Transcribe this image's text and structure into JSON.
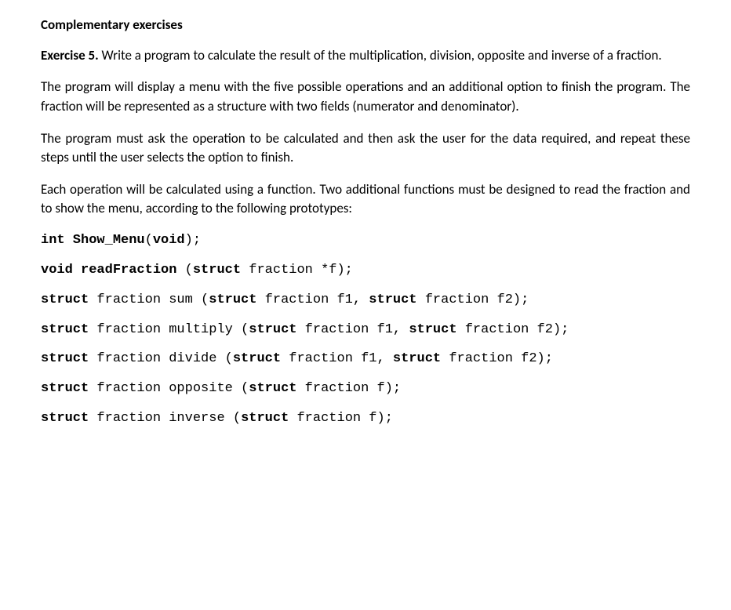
{
  "heading": "Complementary exercises",
  "exercise_label": "Exercise 5.",
  "exercise_text": " Write a program to calculate the result of the multiplication, division, opposite and inverse of a fraction.",
  "para1": "The program will display a menu with the five possible operations and an additional option to finish the program. The fraction will be represented as a structure with two fields (numerator and denominator).",
  "para2": "The program must ask the operation to be calculated and then ask the user for the data required, and repeat these steps until the user selects the option to finish.",
  "para3": "Each operation will be calculated using a function. Two additional functions must be designed to read the fraction and to show the menu, according to the following prototypes:",
  "code": {
    "l1a": "int Show_Menu",
    "l1b": "(",
    "l1c": "void",
    "l1d": ");",
    "l2a": "void readFraction ",
    "l2b": "(",
    "l2c": "struct",
    "l2d": " fraction *f);",
    "l3a": "struct",
    "l3b": " fraction sum (",
    "l3c": "struct",
    "l3d": " fraction f1, ",
    "l3e": "struct",
    "l3f": " fraction f2);",
    "l4a": "struct",
    "l4b": " fraction multiply (",
    "l4c": "struct",
    "l4d": " fraction f1, ",
    "l4e": "struct",
    "l4f": " fraction f2);",
    "l5a": "struct",
    "l5b": " fraction divide (",
    "l5c": "struct",
    "l5d": " fraction f1, ",
    "l5e": "struct",
    "l5f": " fraction f2);",
    "l6a": "struct",
    "l6b": " fraction opposite (",
    "l6c": "struct",
    "l6d": " fraction f);",
    "l7a": "struct",
    "l7b": " fraction inverse (",
    "l7c": "struct",
    "l7d": " fraction f);"
  }
}
